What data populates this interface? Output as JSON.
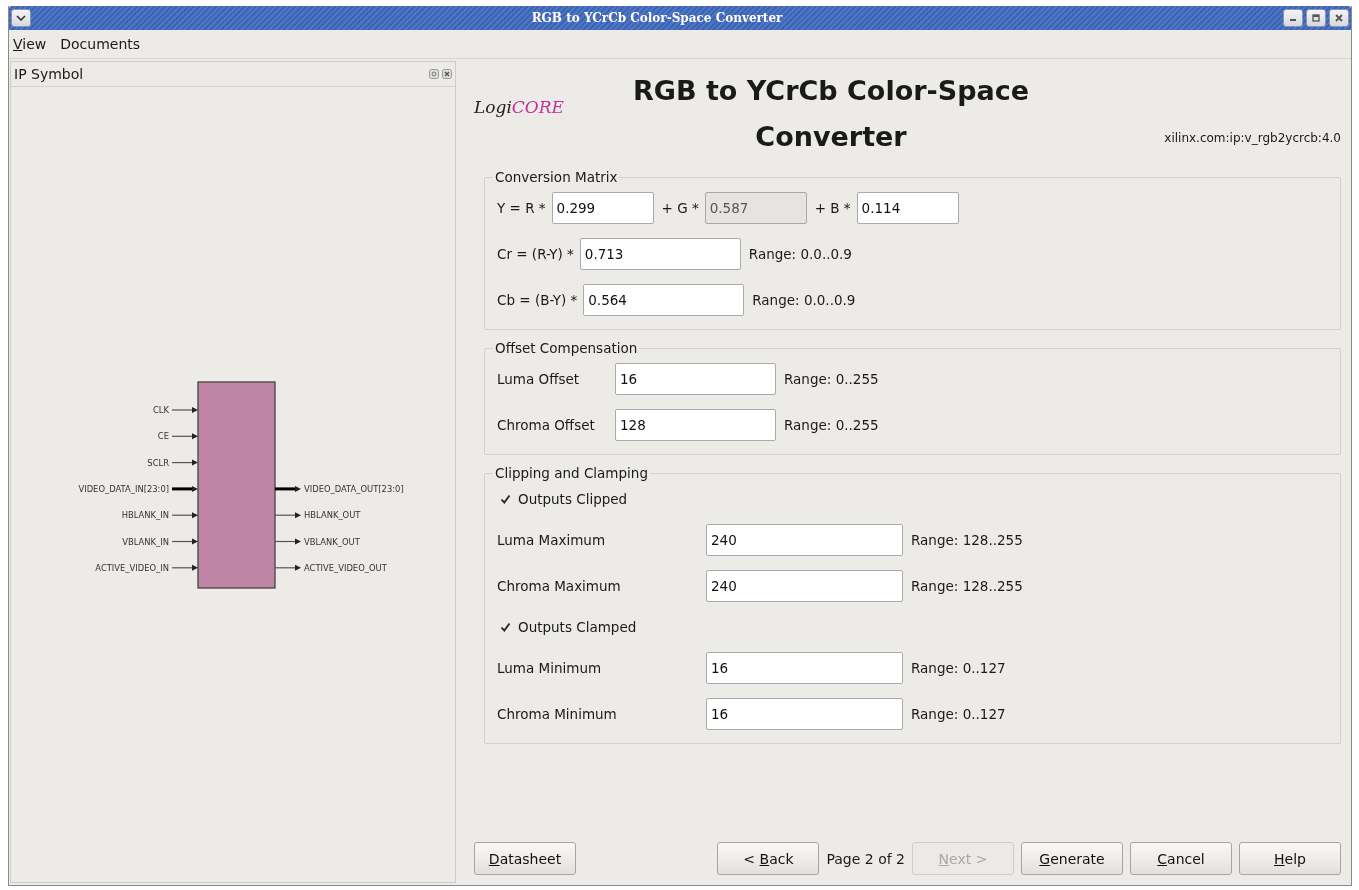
{
  "window": {
    "title": "RGB to YCrCb Color-Space Converter"
  },
  "menu": [
    {
      "label": "View",
      "mnemonic": true
    },
    {
      "label": "Documents"
    }
  ],
  "ip_symbol": {
    "title": "IP Symbol",
    "inputs": [
      {
        "name": "CLK",
        "bus": false
      },
      {
        "name": "CE",
        "bus": false
      },
      {
        "name": "SCLR",
        "bus": false
      },
      {
        "name": "VIDEO_DATA_IN[23:0]",
        "bus": true
      },
      {
        "name": "HBLANK_IN",
        "bus": false
      },
      {
        "name": "VBLANK_IN",
        "bus": false
      },
      {
        "name": "ACTIVE_VIDEO_IN",
        "bus": false
      }
    ],
    "outputs": [
      {
        "name": "VIDEO_DATA_OUT[23:0]",
        "bus": true
      },
      {
        "name": "HBLANK_OUT",
        "bus": false
      },
      {
        "name": "VBLANK_OUT",
        "bus": false
      },
      {
        "name": "ACTIVE_VIDEO_OUT",
        "bus": false
      }
    ]
  },
  "header": {
    "logo_prefix": "Logi",
    "logo_suffix": "CORE",
    "title": "RGB to YCrCb Color-Space Converter",
    "ip_id": "xilinx.com:ip:v_rgb2ycrcb:4.0"
  },
  "conversion_matrix": {
    "title": "Conversion Matrix",
    "y_row": [
      {
        "label": "Y = R *",
        "value": "0.299",
        "disabled": false
      },
      {
        "label": "+ G *",
        "value": "0.587",
        "disabled": true
      },
      {
        "label": "+ B *",
        "value": "0.114",
        "disabled": false
      }
    ],
    "rows": [
      {
        "label": "Cr = (R-Y) *",
        "value": "0.713",
        "range": "Range: 0.0..0.9"
      },
      {
        "label": "Cb = (B-Y) *",
        "value": "0.564",
        "range": "Range: 0.0..0.9"
      }
    ]
  },
  "offset_compensation": {
    "title": "Offset Compensation",
    "rows": [
      {
        "label": "Luma Offset",
        "value": "16",
        "range": "Range: 0..255"
      },
      {
        "label": "Chroma Offset",
        "value": "128",
        "range": "Range: 0..255"
      }
    ]
  },
  "clipping": {
    "title": "Clipping and Clamping",
    "items": [
      {
        "kind": "checkbox",
        "label": "Outputs Clipped",
        "checked": true
      },
      {
        "kind": "field",
        "label": "Luma Maximum",
        "value": "240",
        "range": "Range: 128..255"
      },
      {
        "kind": "field",
        "label": "Chroma Maximum",
        "value": "240",
        "range": "Range: 128..255"
      },
      {
        "kind": "checkbox",
        "label": "Outputs Clamped",
        "checked": true
      },
      {
        "kind": "field",
        "label": "Luma Minimum",
        "value": "16",
        "range": "Range: 0..127"
      },
      {
        "kind": "field",
        "label": "Chroma Minimum",
        "value": "16",
        "range": "Range: 0..127"
      }
    ]
  },
  "footer": {
    "datasheet": {
      "label": "Datasheet",
      "mnemonic": true,
      "disabled": false
    },
    "back": {
      "label": "< Back",
      "mnemonic": true,
      "disabled": false
    },
    "page": "Page 2 of 2",
    "buttons": [
      {
        "label": "Next >",
        "mnemonic": true,
        "disabled": true
      },
      {
        "label": "Generate",
        "mnemonic": true,
        "disabled": false
      },
      {
        "label": "Cancel",
        "mnemonic": true,
        "disabled": false
      },
      {
        "label": "Help",
        "mnemonic": true,
        "disabled": false
      }
    ]
  }
}
